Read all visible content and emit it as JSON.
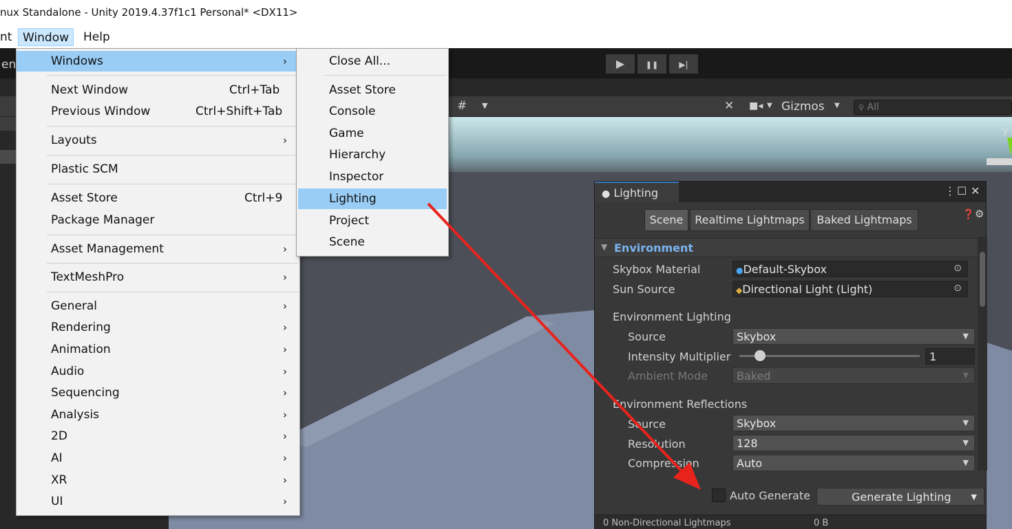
{
  "window_title": "nux Standalone - Unity 2019.4.37f1c1 Personal* <DX11>",
  "menubar": {
    "partial_item": "nt",
    "window": "Window",
    "help": "Help"
  },
  "toolbar": {
    "play": "▶",
    "pause": "❚❚",
    "step": "▶|"
  },
  "scene_toolbar": {
    "gizmos_label": "Gizmos",
    "search_placeholder": "All",
    "left_partial": "ent"
  },
  "window_menu": {
    "items": [
      {
        "label": "Windows",
        "shortcut": "",
        "submenu": true,
        "highlighted": true
      },
      {
        "label": "Next Window",
        "shortcut": "Ctrl+Tab"
      },
      {
        "label": "Previous Window",
        "shortcut": "Ctrl+Shift+Tab"
      },
      {
        "label": "Layouts",
        "shortcut": "",
        "submenu": true
      },
      {
        "label": "Plastic SCM",
        "shortcut": ""
      },
      {
        "label": "Asset Store",
        "shortcut": "Ctrl+9"
      },
      {
        "label": "Package Manager",
        "shortcut": ""
      },
      {
        "label": "Asset Management",
        "shortcut": "",
        "submenu": true
      },
      {
        "label": "TextMeshPro",
        "shortcut": "",
        "submenu": true
      },
      {
        "label": "General",
        "submenu": true
      },
      {
        "label": "Rendering",
        "submenu": true
      },
      {
        "label": "Animation",
        "submenu": true
      },
      {
        "label": "Audio",
        "submenu": true
      },
      {
        "label": "Sequencing",
        "submenu": true
      },
      {
        "label": "Analysis",
        "submenu": true
      },
      {
        "label": "2D",
        "submenu": true
      },
      {
        "label": "AI",
        "submenu": true
      },
      {
        "label": "XR",
        "submenu": true
      },
      {
        "label": "UI",
        "submenu": true
      }
    ],
    "submenu_arrow": "›"
  },
  "windows_submenu": {
    "items": [
      {
        "label": "Close All..."
      },
      {
        "label": "Asset Store"
      },
      {
        "label": "Console"
      },
      {
        "label": "Game"
      },
      {
        "label": "Hierarchy"
      },
      {
        "label": "Inspector"
      },
      {
        "label": "Lighting",
        "highlighted": true
      },
      {
        "label": "Project"
      },
      {
        "label": "Scene"
      }
    ]
  },
  "lighting": {
    "tab_title": "Lighting",
    "subtabs": [
      "Scene",
      "Realtime Lightmaps",
      "Baked Lightmaps"
    ],
    "section": "Environment",
    "skybox_material_label": "Skybox Material",
    "skybox_material_value": "Default-Skybox",
    "sun_source_label": "Sun Source",
    "sun_source_value": "Directional Light (Light)",
    "env_lighting_label": "Environment Lighting",
    "source_label": "Source",
    "source_value": "Skybox",
    "intensity_label": "Intensity Multiplier",
    "intensity_value": "1",
    "ambient_mode_label": "Ambient Mode",
    "ambient_mode_value": "Baked",
    "env_reflections_label": "Environment Reflections",
    "refl_source_label": "Source",
    "refl_source_value": "Skybox",
    "resolution_label": "Resolution",
    "resolution_value": "128",
    "compression_label": "Compression",
    "compression_value": "Auto",
    "auto_generate_label": "Auto Generate",
    "generate_button": "Generate Lighting",
    "footer_label": "0 Non-Directional Lightmaps",
    "footer_size": "0 B"
  },
  "colors": {
    "menu_highlight": "#99cdf5",
    "annotation_arrow": "#e8231c",
    "section_header": "#7bb3f0"
  }
}
